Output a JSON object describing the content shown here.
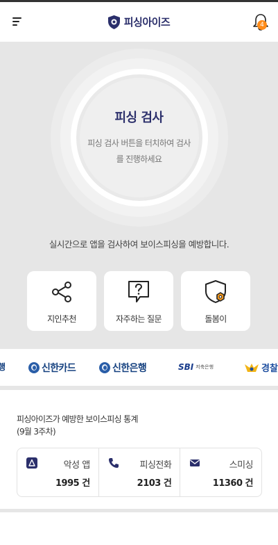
{
  "header": {
    "app_name": "피싱아이즈",
    "notification_count": "4",
    "accent_color": "#2b2f6b",
    "badge_color": "#ff8c1a"
  },
  "scan": {
    "title": "피싱 검사",
    "description": "피싱 검사 버튼을 터치하여 검사를 진행하세요"
  },
  "notice": "실시간으로 앱을 검사하여 보이스피싱을 예방합니다.",
  "actions": [
    {
      "label": "지인추천",
      "icon": "share-icon"
    },
    {
      "label": "자주하는 질문",
      "icon": "question-icon"
    },
    {
      "label": "돌봄이",
      "icon": "shield-icon"
    }
  ],
  "partners": {
    "edge_left": "행",
    "shinhan_card": "신한카드",
    "shinhan_bank": "신한은행",
    "sbi": "SBI",
    "sbi_sub": "저축은행",
    "police": "경찰"
  },
  "stats": {
    "title": "피싱아이즈가 예방한 보이스피싱 통계",
    "period": "(9월 3주차)",
    "items": [
      {
        "label": "악성 앱",
        "value": "1995 건",
        "icon": "app-icon"
      },
      {
        "label": "피싱전화",
        "value": "2103 건",
        "icon": "phone-icon"
      },
      {
        "label": "스미싱",
        "value": "11360 건",
        "icon": "mail-icon"
      }
    ]
  }
}
